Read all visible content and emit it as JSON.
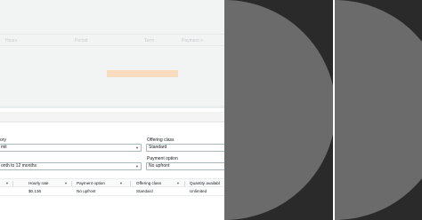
{
  "background_panel": {
    "columns": [
      "Hours",
      "Period",
      "Term",
      "Payment o"
    ]
  },
  "form": {
    "fields": [
      {
        "label": "ory",
        "value": "mit"
      },
      {
        "label": "Offering class",
        "value": "Standard"
      },
      {
        "label": "",
        "value": "onth to 12 months"
      },
      {
        "label": "Payment option",
        "value": "No upfront"
      }
    ]
  },
  "table": {
    "headers": [
      "Hourly rate",
      "Payment option",
      "Offering class",
      "Quantity availabl"
    ],
    "rows": [
      [
        "$0.136",
        "No upfront",
        "Standard",
        "Unlimited"
      ]
    ]
  },
  "colors": {
    "accent_faded": "#f9dcc0",
    "dark_panel": "#2a2a2a",
    "circle": "#6b6b6b"
  }
}
